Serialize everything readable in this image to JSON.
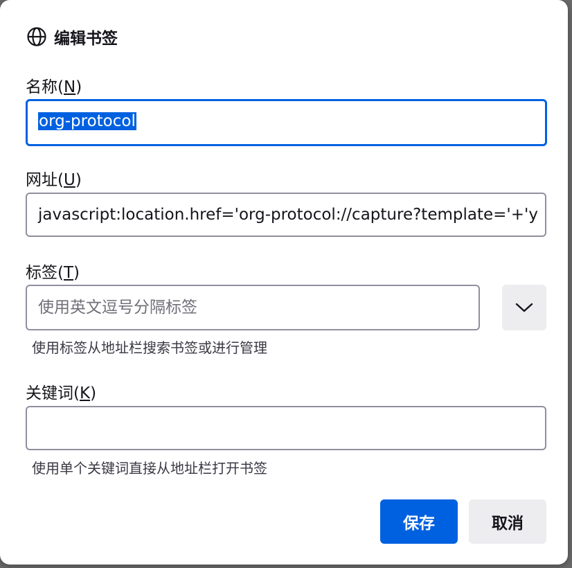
{
  "dialog": {
    "title": "编辑书签",
    "icon": "globe-icon"
  },
  "name": {
    "label_text": "名称(",
    "label_key": "N",
    "label_end": ")",
    "value": "org-protocol"
  },
  "url": {
    "label_text": "网址(",
    "label_key": "U",
    "label_end": ")",
    "value": "javascript:location.href='org-protocol://capture?template='+'y"
  },
  "tags": {
    "label_text": "标签(",
    "label_key": "T",
    "label_end": ")",
    "placeholder": "使用英文逗号分隔标签",
    "hint": "使用标签从地址栏搜索书签或进行管理",
    "dropdown_icon": "chevron-down-icon"
  },
  "keyword": {
    "label_text": "关键词(",
    "label_key": "K",
    "label_end": ")",
    "value": "",
    "hint": "使用单个关键词直接从地址栏打开书签"
  },
  "buttons": {
    "save": "保存",
    "cancel": "取消"
  },
  "colors": {
    "accent": "#0061e0",
    "button_secondary_bg": "#ededf0",
    "border": "#8f8f9d"
  }
}
